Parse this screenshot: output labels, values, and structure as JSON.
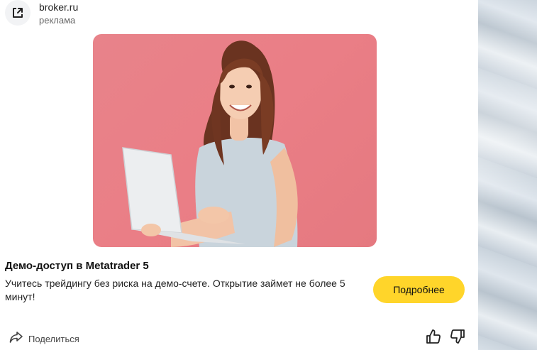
{
  "source": {
    "domain": "broker.ru",
    "label": "реклама",
    "icon": "external-link-icon"
  },
  "ad": {
    "title": "Демо-доступ в Metatrader 5",
    "description": "Учитесь трейдингу без риска на демо-счете. Открытие займет не более 5 минут!",
    "cta_label": "Подробнее",
    "image": "woman-with-laptop-photo"
  },
  "footer": {
    "share_label": "Поделиться",
    "share_icon": "share-arrow-icon",
    "like_icon": "thumbs-up-icon",
    "dislike_icon": "thumbs-down-icon"
  },
  "colors": {
    "cta": "#ffd52a",
    "hero_background": "#e8838a"
  }
}
